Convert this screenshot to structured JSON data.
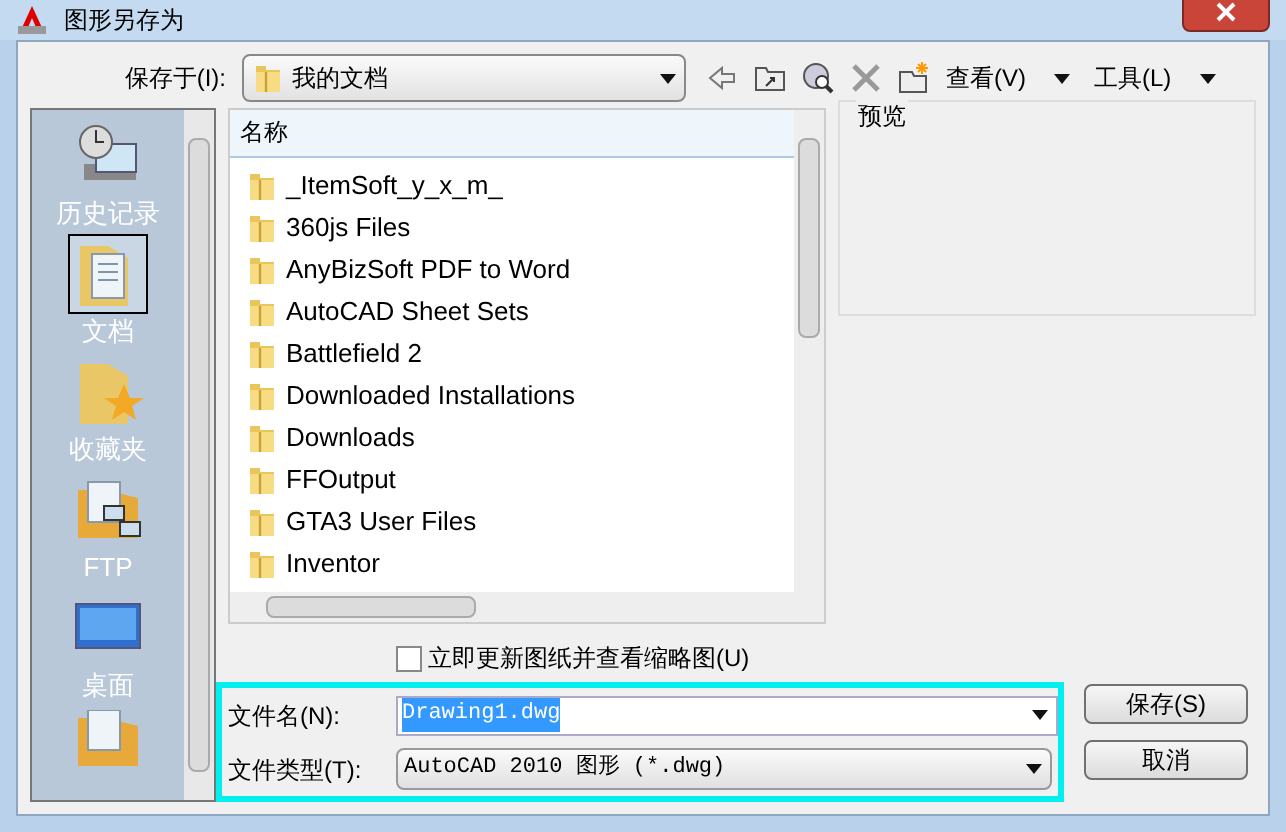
{
  "window": {
    "title": "图形另存为"
  },
  "save_in": {
    "label": "保存于(I):",
    "value": "我的文档"
  },
  "toolbar": {
    "view": "查看(V)",
    "tools": "工具(L)"
  },
  "places": [
    {
      "label": "历史记录",
      "kind": "history",
      "selected": false
    },
    {
      "label": "文档",
      "kind": "documents",
      "selected": true
    },
    {
      "label": "收藏夹",
      "kind": "favorites",
      "selected": false
    },
    {
      "label": "FTP",
      "kind": "ftp",
      "selected": false
    },
    {
      "label": "桌面",
      "kind": "desktop",
      "selected": false
    },
    {
      "kind": "network",
      "selected": false
    }
  ],
  "file_list": {
    "column": "名称",
    "items": [
      "_ItemSoft_y_x_m_",
      "360js Files",
      "AnyBizSoft PDF to Word",
      "AutoCAD Sheet Sets",
      "Battlefield 2",
      "Downloaded Installations",
      "Downloads",
      "FFOutput",
      "GTA3 User Files",
      "Inventor"
    ]
  },
  "preview": {
    "label": "预览"
  },
  "update_thumbnail": {
    "label": "立即更新图纸并查看缩略图(U)",
    "checked": false
  },
  "file_name": {
    "label": "文件名(N):",
    "value": "Drawing1.dwg",
    "value_selected": true
  },
  "file_type": {
    "label": "文件类型(T):",
    "value": "AutoCAD 2010 图形 (*.dwg)"
  },
  "buttons": [
    "保存(S)",
    "取消"
  ]
}
